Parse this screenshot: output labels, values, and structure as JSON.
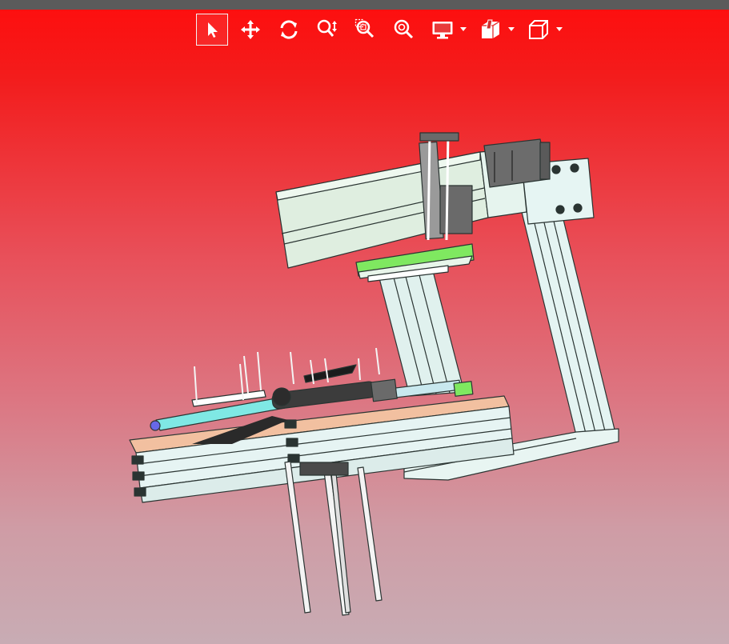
{
  "app": {
    "kind": "3D CAD model viewer",
    "background_colors": [
      "#ff0d0d",
      "#c8acb4"
    ],
    "topbar_color": "#5b5b5b"
  },
  "toolbar": {
    "buttons": [
      {
        "name": "select-button",
        "icon": "pointer-arrow-icon",
        "active": true
      },
      {
        "name": "pan-button",
        "icon": "move-arrows-icon",
        "active": false
      },
      {
        "name": "rotate-button",
        "icon": "rotate-icon",
        "active": false
      },
      {
        "name": "zoom-in-out-button",
        "icon": "zoom-updown-icon",
        "active": false
      },
      {
        "name": "zoom-window-button",
        "icon": "zoom-window-icon",
        "active": false
      },
      {
        "name": "zoom-fit-button",
        "icon": "zoom-fit-icon",
        "active": false
      },
      {
        "name": "display-mode-button",
        "icon": "monitor-icon",
        "dropdown": true
      },
      {
        "name": "section-view-button",
        "icon": "section-cube-icon",
        "dropdown": true
      },
      {
        "name": "standard-views-button",
        "icon": "cube-icon",
        "dropdown": true
      }
    ],
    "active_border_color": "#f2f2f2",
    "icon_color": "#ffffff"
  },
  "model": {
    "description_colors": {
      "frame": "#e4f4f2",
      "frame_edge": "#2a3432",
      "actuator_body": "#dfeee0",
      "motor": "#6c6c6c",
      "green_plate": "#7fe860",
      "copper_plate": "#f2c0a0",
      "cylinder": "#3c3c3c",
      "cyan_rail": "#7fe8e4",
      "blue_knob": "#6868e8"
    }
  }
}
